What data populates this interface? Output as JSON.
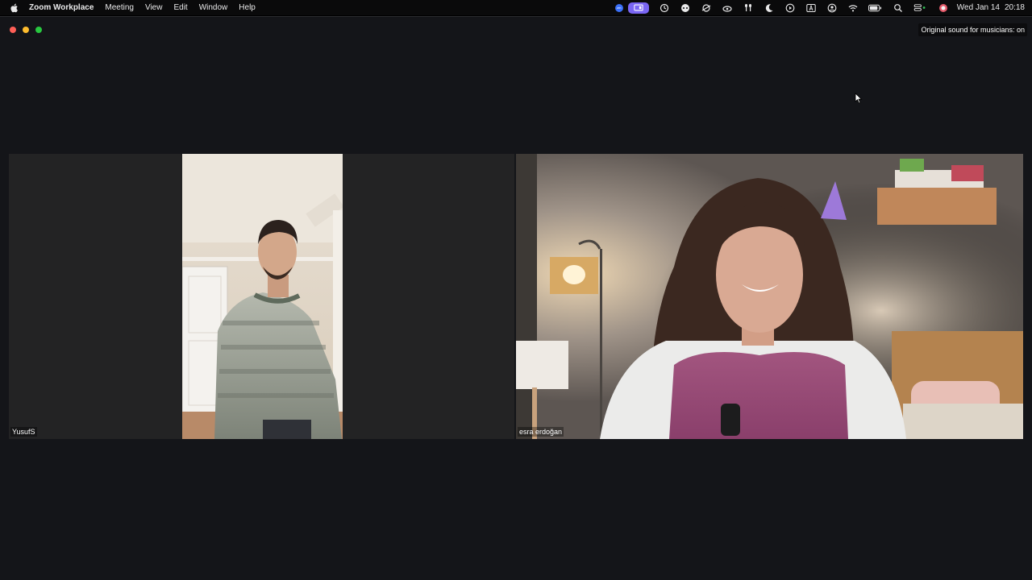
{
  "menubar": {
    "apple_icon": "apple-icon",
    "items": [
      "Zoom Workplace",
      "Meeting",
      "View",
      "Edit",
      "Window",
      "Help"
    ],
    "status_icons": [
      "zoom-status-icon",
      "screen-share-icon",
      "sync-icon",
      "chat-bubble-icon",
      "planet-icon",
      "cloud-icon",
      "airpods-icon",
      "moon-icon",
      "play-icon",
      "text-input-icon",
      "user-circle-icon",
      "wifi-icon",
      "battery-icon",
      "search-icon",
      "control-center-icon",
      "siri-icon"
    ],
    "clock_date": "Wed Jan 14",
    "clock_time": "20:18"
  },
  "window": {
    "sound_status": "Original sound for musicians: on"
  },
  "participants": [
    {
      "name": "YusufS"
    },
    {
      "name": "esra erdoğan"
    }
  ],
  "colors": {
    "window_bg": "#141519",
    "tile_bg": "#232324",
    "share_pill": "#7a66f4",
    "traffic_red": "#ff5f57",
    "traffic_yellow": "#febc2e",
    "traffic_green": "#28c840"
  }
}
